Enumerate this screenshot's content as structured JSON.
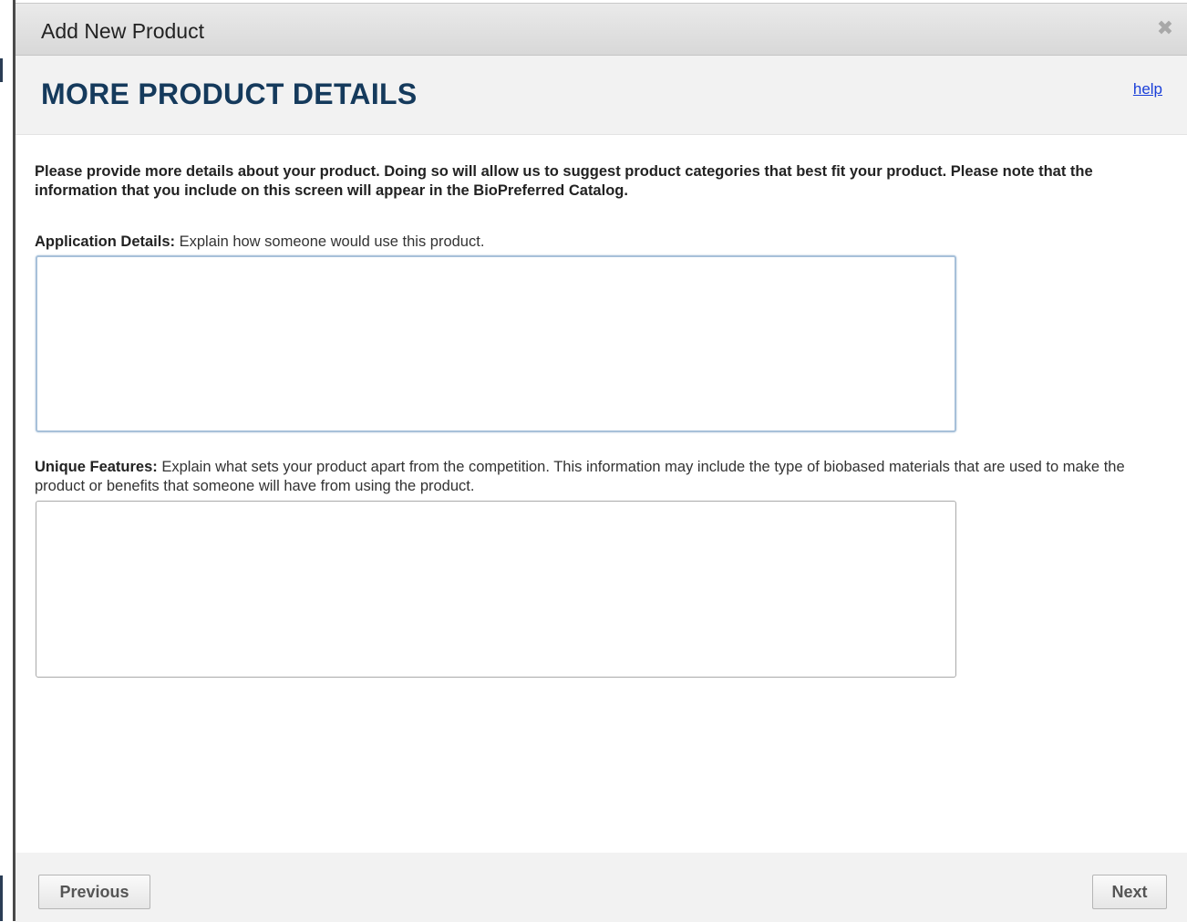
{
  "dialog": {
    "title": "Add New Product",
    "close_icon": "close-icon",
    "close_glyph": "✖"
  },
  "header": {
    "heading": "MORE PRODUCT DETAILS",
    "help_link": "help"
  },
  "intro": "Please provide more details about your product. Doing so will allow us to suggest product categories that best fit your product. Please note that the information that you include on this screen will appear in the BioPreferred Catalog.",
  "fields": {
    "application": {
      "label": "Application Details:",
      "hint": "Explain how someone would use this product.",
      "value": ""
    },
    "unique": {
      "label": "Unique Features:",
      "hint": "Explain what sets your product apart from the competition. This information may include the type of biobased materials that are used to make the product or benefits that someone will have from using the product.",
      "value": ""
    }
  },
  "footer": {
    "previous_label": "Previous",
    "next_label": "Next"
  },
  "colors": {
    "heading": "#153a5c",
    "link": "#1a3fd9",
    "titlebar": "#dcdcdc",
    "panel": "#f2f2f2"
  }
}
